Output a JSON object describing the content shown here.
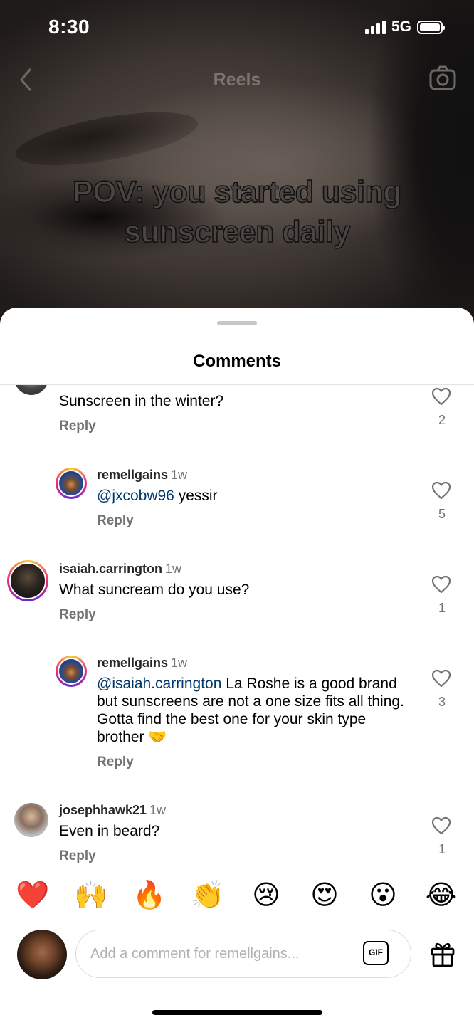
{
  "status_bar": {
    "time": "8:30",
    "network": "5G"
  },
  "video": {
    "header_title": "Reels",
    "caption_line1": "POV: you started using",
    "caption_line2": "sunscreen daily"
  },
  "sheet": {
    "title": "Comments"
  },
  "comments": [
    {
      "username": "",
      "time": "",
      "text": "Sunscreen in the winter?",
      "reply": "Reply",
      "likes": "2"
    },
    {
      "username": "remellgains",
      "time": "1w",
      "mention": "@jxcobw96",
      "text": " yessir",
      "reply": "Reply",
      "likes": "5"
    },
    {
      "username": "isaiah.carrington",
      "time": "1w",
      "text": "What suncream do you use?",
      "reply": "Reply",
      "likes": "1"
    },
    {
      "username": "remellgains",
      "time": "1w",
      "mention": "@isaiah.carrington",
      "text": " La Roshe is a good brand but sunscreens are not a one size fits all thing. Gotta find the best one for your skin type brother 🤝",
      "reply": "Reply",
      "likes": "3"
    },
    {
      "username": "josephhawk21",
      "time": "1w",
      "text": "Even in beard?",
      "reply": "Reply",
      "likes": "1"
    }
  ],
  "emoji_bar": [
    "❤️",
    "🙌",
    "🔥",
    "👏",
    "😢",
    "😍",
    "😮",
    "😂"
  ],
  "composer": {
    "placeholder": "Add a comment for remellgains...",
    "gif_label": "GIF"
  },
  "colors": {
    "mention": "#00376b",
    "secondary_text": "#737373",
    "like_red": "#ed4956"
  }
}
